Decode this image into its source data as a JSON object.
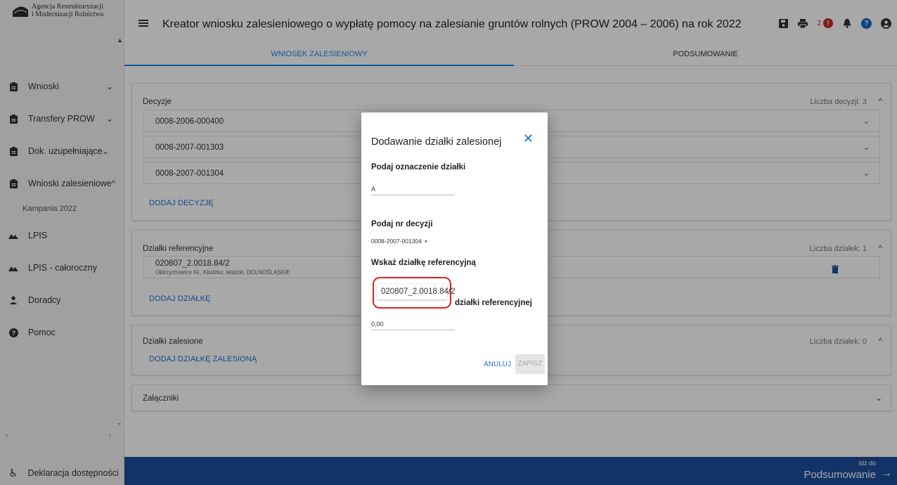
{
  "sidebar": {
    "logo_line1": "Agencja Restrukturyzacji",
    "logo_line2": "i Modernizacji Rolnictwa",
    "items": [
      {
        "label": "Wnioski"
      },
      {
        "label": "Transfery PROW"
      },
      {
        "label": "Dok. uzupełniające"
      },
      {
        "label": "Wnioski zalesieniowe"
      },
      {
        "label": "Kampania 2022"
      },
      {
        "label": "LPIS"
      },
      {
        "label": "LPIS - całoroczny"
      },
      {
        "label": "Doradcy"
      },
      {
        "label": "Pomoc"
      }
    ],
    "accessibility_label": "Deklaracja dostępności"
  },
  "header": {
    "title": "Kreator wniosku zalesieniowego o wypłatę pomocy na zalesianie gruntów rolnych (PROW 2004 – 2006) na rok 2022",
    "error_count": "2"
  },
  "tabs": [
    {
      "label": "WNIOSEK ZALESIENIOWY"
    },
    {
      "label": "PODSUMOWANIE"
    }
  ],
  "decisions": {
    "title": "Decyzje",
    "count": "Liczba decyzji: 3",
    "items": [
      "0008-2006-000400",
      "0008-2007-001303",
      "0008-2007-001304"
    ],
    "add_label": "DODAJ DECYZJĘ"
  },
  "reference_plots": {
    "title": "Działki referencyjne",
    "count": "Liczba działek: 1",
    "items": [
      {
        "id": "020807_2.0018.84/2",
        "location": "Ołdrzychowice Kł., Kłodzko, kłodzki, DOLNOŚLĄSKIE"
      }
    ],
    "add_label": "DODAJ DZIAŁKĘ"
  },
  "forested_plots": {
    "title": "Działki zalesione",
    "count": "Liczba działek: 0",
    "add_label": "DODAJ DZIAŁKĘ ZALESIONĄ"
  },
  "attachments": {
    "title": "Załączniki"
  },
  "footer": {
    "goto_label": "Idź do",
    "target_label": "Podsumowanie"
  },
  "dialog": {
    "title": "Dodawanie działki zalesionej",
    "plot_label": "Podaj oznaczenie działki",
    "plot_value": "A",
    "decision_label": "Podaj nr decyzji",
    "decision_value": "0008-2007-001304",
    "ref_plot_label": "Wskaż działkę referencyjną",
    "ref_plot_value": "020807_2.0018.84/2",
    "area_label_tail": "działki referencyjnej",
    "area_value": "0,00",
    "cancel_label": "ANULUJ",
    "save_label": "ZAPISZ"
  },
  "colors": {
    "accent": "#1e88e5",
    "footer": "#1c4e9c",
    "error": "#c62828",
    "highlight": "#e02020"
  }
}
